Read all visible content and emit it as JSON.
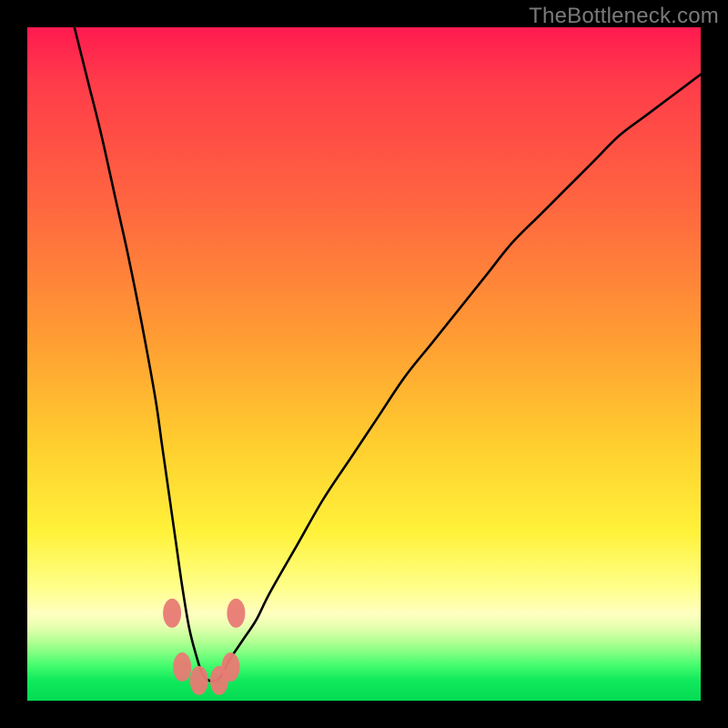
{
  "watermark": {
    "text": "TheBottleneck.com"
  },
  "colors": {
    "frame": "#000000",
    "curve_stroke": "#000000",
    "marker_fill": "#e97a74",
    "marker_stroke": "#b55752",
    "gradient_stops": [
      "#ff1a50",
      "#ff3b4a",
      "#ff6a3f",
      "#ff9c33",
      "#ffce2f",
      "#fff23a",
      "#ffff88",
      "#ffffc0",
      "#e6ffb0",
      "#b8ff96",
      "#7dff80",
      "#3dfb6c",
      "#11e95c",
      "#04db54"
    ]
  },
  "chart_data": {
    "type": "line",
    "title": "",
    "xlabel": "",
    "ylabel": "",
    "xlim": [
      0,
      100
    ],
    "ylim": [
      0,
      100
    ],
    "note": "Axes are unlabeled in the source image. x and y are normalized 0–100. Low y = bottom (green / good), high y = top (red / bad). The single black curve shows a V-shaped bottleneck profile with its minimum near x≈26, y≈3.",
    "series": [
      {
        "name": "bottleneck-curve",
        "x": [
          7,
          9,
          11,
          13,
          15,
          17,
          19,
          20,
          21,
          22,
          23,
          24,
          25,
          26,
          27,
          28,
          29,
          30,
          32,
          34,
          36,
          40,
          44,
          48,
          52,
          56,
          60,
          64,
          68,
          72,
          76,
          80,
          84,
          88,
          92,
          96,
          100
        ],
        "y": [
          100,
          92,
          84,
          75,
          66,
          56,
          45,
          38,
          31,
          24,
          17,
          11,
          7,
          4,
          3,
          3,
          4,
          6,
          9,
          12,
          16,
          23,
          30,
          36,
          42,
          48,
          53,
          58,
          63,
          68,
          72,
          76,
          80,
          84,
          87,
          90,
          93
        ]
      }
    ],
    "markers": [
      {
        "name": "left-upper",
        "x": 21.5,
        "y": 13
      },
      {
        "name": "left-lower",
        "x": 23.0,
        "y": 5
      },
      {
        "name": "min-left",
        "x": 25.5,
        "y": 3
      },
      {
        "name": "min-right",
        "x": 28.5,
        "y": 3
      },
      {
        "name": "right-lower",
        "x": 30.2,
        "y": 5
      },
      {
        "name": "right-upper",
        "x": 31.0,
        "y": 13
      }
    ]
  }
}
